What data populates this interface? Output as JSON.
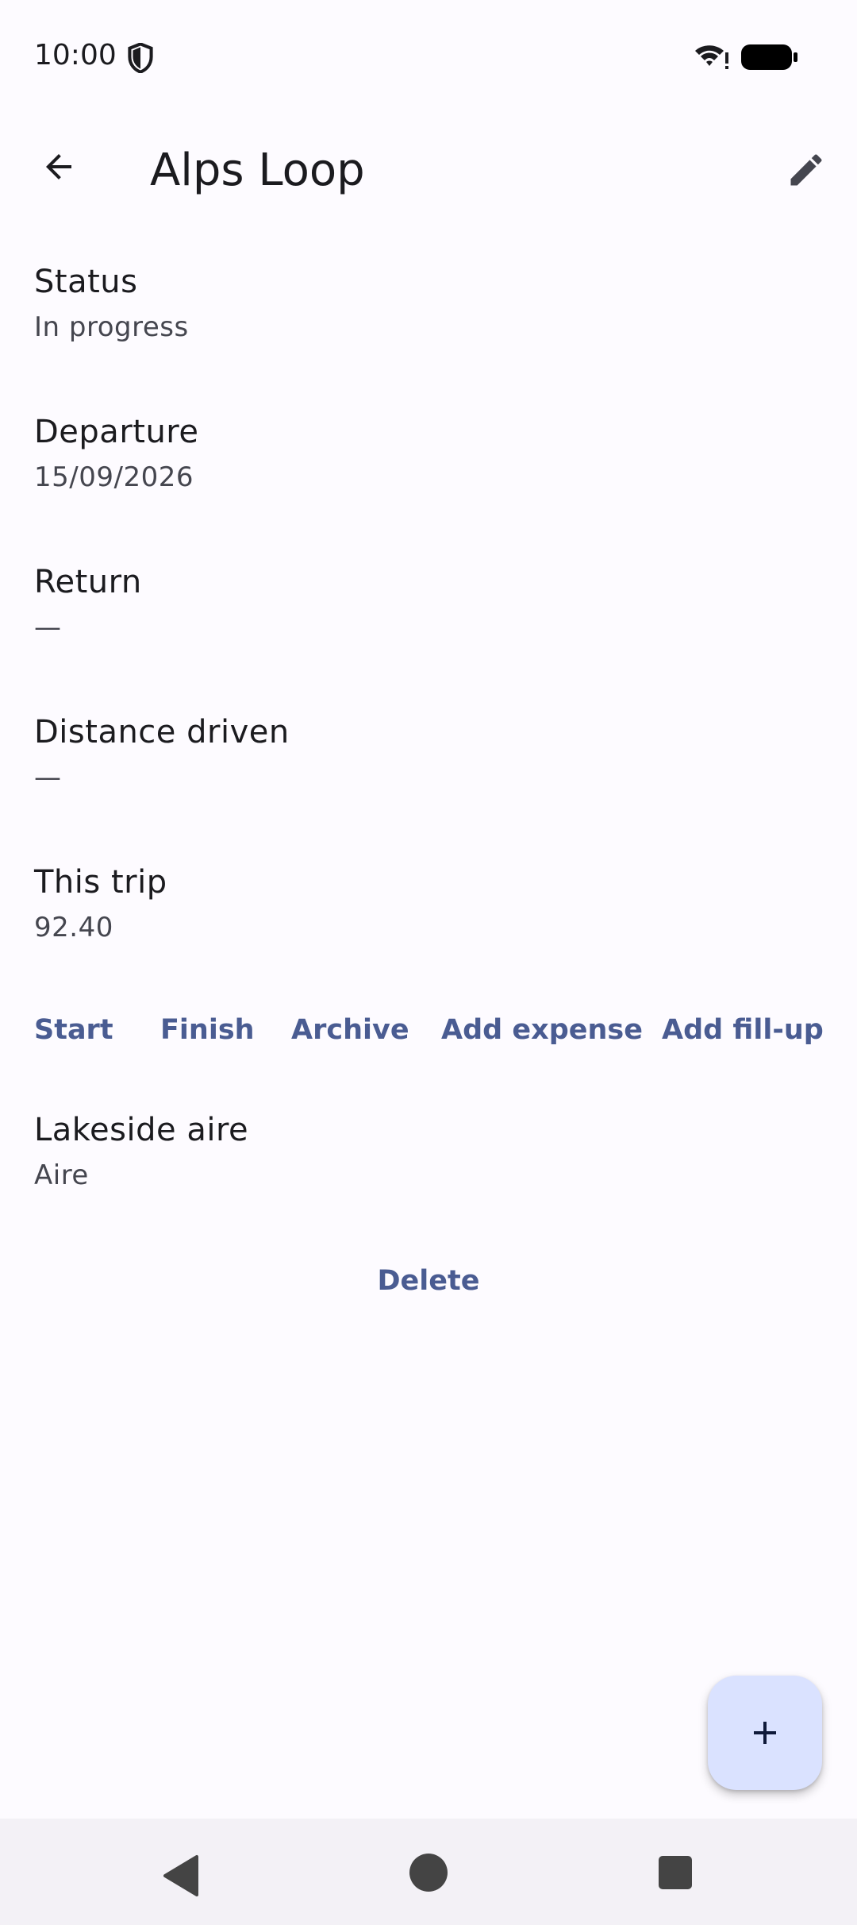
{
  "status_bar": {
    "time": "10:00",
    "icons": [
      "shield-icon",
      "wifi-icon",
      "battery-icon"
    ]
  },
  "app_bar": {
    "title": "Alps Loop",
    "back_icon": "arrow-back-icon",
    "edit_icon": "pencil-icon"
  },
  "fields": [
    {
      "label": "Status",
      "value": "In progress"
    },
    {
      "label": "Departure",
      "value": "15/09/2026"
    },
    {
      "label": "Return",
      "value": "—"
    },
    {
      "label": "Distance driven",
      "value": "—"
    },
    {
      "label": "This trip",
      "value": "92.40"
    }
  ],
  "actions": {
    "start": "Start",
    "finish": "Finish",
    "archive": "Archive",
    "add_expense": "Add expense",
    "add_fillup": "Add fill-up"
  },
  "stop": {
    "name": "Lakeside aire",
    "type": "Aire"
  },
  "delete_label": "Delete",
  "fab_icon": "plus-icon",
  "colors": {
    "background": "#fdfbff",
    "accent_text": "#4a5c92",
    "fab_background": "#dae2ff",
    "nav_background": "#f3f1f6"
  }
}
